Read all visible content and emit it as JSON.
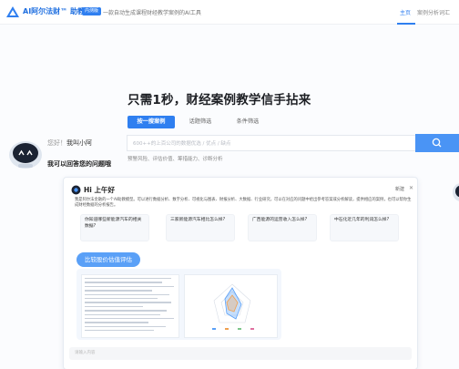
{
  "header": {
    "logo_text": "AI阿尔法财™ 助教",
    "beta_badge": "内测版",
    "description": "一款自动生成课程财经教学案例的AI工具",
    "nav_home": "主页",
    "nav_other": "案例分析词汇"
  },
  "hero": {
    "title": "只需1秒，财经案例教学信手拈来",
    "tabs": [
      {
        "label": "按一搜案例",
        "active": true
      },
      {
        "label": "话题筛选",
        "active": false
      },
      {
        "label": "条件筛选",
        "active": false
      }
    ],
    "search_placeholder": "600++的上百公司的数据优选 / 优点 / 缺点",
    "hot_tags": "预警风险、评估价值、筹措能力、诊断分析"
  },
  "assistant": {
    "greeting_prefix": "您好！",
    "greeting_name": "我叫小阿",
    "ask": "我可以回答您的问题哦"
  },
  "preview": {
    "greeting": "Hi 上午好",
    "new_chat": "新建",
    "intro": "我是阿尔法金融的一个AI助教模型。可以进行数据分析、数字分析、可视化与图表、财报分析、大数据、行业研究，可以在对应的问题中给出参考答案或分析解读，提供相应的案例，也可以帮你生成财经数据的分析报告。",
    "questions": [
      "你知道哪些新能源汽车的相关数据?",
      "三家新能源汽车相比怎么样?",
      "广西能源的运营收入怎么样?",
      "中石化近几年的利润怎么样?"
    ],
    "compare_button": "比较股价估值评估",
    "input_placeholder": "请输入内容"
  },
  "colors": {
    "accent": "#2f7ff0",
    "search_button": "#4a94f5",
    "title": "#1d1f24"
  },
  "icons": [
    "logo-icon",
    "search-icon",
    "robot-avatar-icon",
    "close-icon"
  ]
}
